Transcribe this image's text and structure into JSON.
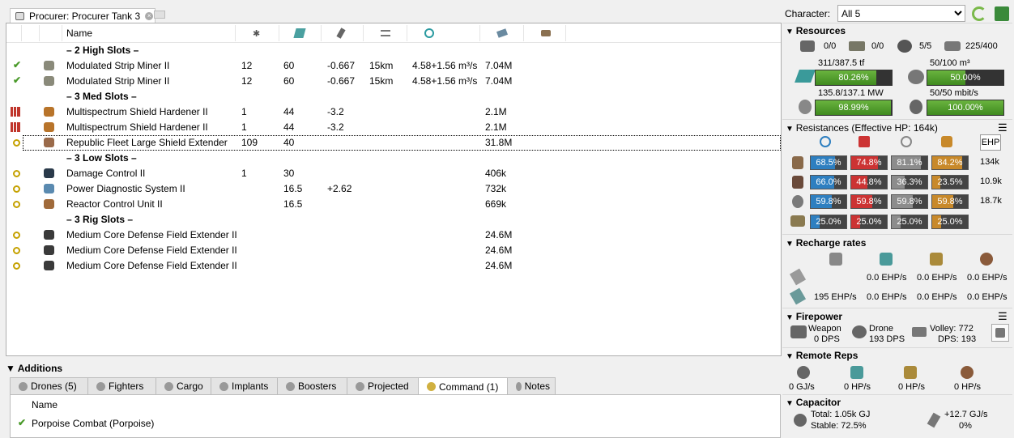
{
  "doc_tab": {
    "title": "Procurer: Procurer Tank 3"
  },
  "grid": {
    "header_name": "Name",
    "rows": [
      {
        "kind": "group",
        "name": "– 2 High Slots –"
      },
      {
        "kind": "mod",
        "status": "check",
        "icon_color": "#8a8a7a",
        "name": "Modulated Strip Miner II",
        "c1": "12",
        "c2": "60",
        "c3": "-0.667",
        "c4": "15km",
        "c5": "4.58+1.56 m³/s",
        "c6": "7.04M"
      },
      {
        "kind": "mod",
        "status": "check",
        "icon_color": "#8a8a7a",
        "name": "Modulated Strip Miner II",
        "c1": "12",
        "c2": "60",
        "c3": "-0.667",
        "c4": "15km",
        "c5": "4.58+1.56 m³/s",
        "c6": "7.04M"
      },
      {
        "kind": "group",
        "name": "– 3 Med Slots –"
      },
      {
        "kind": "mod",
        "status": "overload",
        "icon_color": "#b8742a",
        "name": "Multispectrum Shield Hardener II",
        "c1": "1",
        "c2": "44",
        "c3": "-3.2",
        "c4": "",
        "c5": "",
        "c6": "2.1M"
      },
      {
        "kind": "mod",
        "status": "overload",
        "icon_color": "#b8742a",
        "name": "Multispectrum Shield Hardener II",
        "c1": "1",
        "c2": "44",
        "c3": "-3.2",
        "c4": "",
        "c5": "",
        "c6": "2.1M"
      },
      {
        "kind": "mod",
        "status": "online",
        "icon_color": "#9a6a4a",
        "name": "Republic Fleet Large Shield Extender",
        "c1": "109",
        "c2": "40",
        "c3": "",
        "c4": "",
        "c5": "",
        "c6": "31.8M",
        "selected": true
      },
      {
        "kind": "group",
        "name": "– 3 Low Slots –"
      },
      {
        "kind": "mod",
        "status": "online",
        "icon_color": "#2a3a4a",
        "name": "Damage Control II",
        "c1": "1",
        "c2": "30",
        "c3": "",
        "c4": "",
        "c5": "",
        "c6": "406k"
      },
      {
        "kind": "mod",
        "status": "online",
        "icon_color": "#5a8ab0",
        "name": "Power Diagnostic System II",
        "c1": "",
        "c2": "16.5",
        "c3": "+2.62",
        "c4": "",
        "c5": "",
        "c6": "732k"
      },
      {
        "kind": "mod",
        "status": "online",
        "icon_color": "#a06a3a",
        "name": "Reactor Control Unit II",
        "c1": "",
        "c2": "16.5",
        "c3": "",
        "c4": "",
        "c5": "",
        "c6": "669k"
      },
      {
        "kind": "group",
        "name": "– 3 Rig Slots –"
      },
      {
        "kind": "mod",
        "status": "online",
        "icon_color": "#3a3a3a",
        "name": "Medium Core Defense Field Extender II",
        "c1": "",
        "c2": "",
        "c3": "",
        "c4": "",
        "c5": "",
        "c6": "24.6M"
      },
      {
        "kind": "mod",
        "status": "online",
        "icon_color": "#3a3a3a",
        "name": "Medium Core Defense Field Extender II",
        "c1": "",
        "c2": "",
        "c3": "",
        "c4": "",
        "c5": "",
        "c6": "24.6M"
      },
      {
        "kind": "mod",
        "status": "online",
        "icon_color": "#3a3a3a",
        "name": "Medium Core Defense Field Extender II",
        "c1": "",
        "c2": "",
        "c3": "",
        "c4": "",
        "c5": "",
        "c6": "24.6M"
      }
    ]
  },
  "additions": {
    "title": "Additions",
    "tabs": [
      "Drones (5)",
      "Fighters",
      "Cargo",
      "Implants",
      "Boosters",
      "Projected",
      "Command (1)",
      "Notes"
    ],
    "active_tab": 6,
    "col_name": "Name",
    "item": "Porpoise Combat (Porpoise)"
  },
  "character": {
    "label": "Character:",
    "value": "All 5"
  },
  "resources": {
    "title": "Resources",
    "counts": [
      "0/0",
      "0/0",
      "5/5",
      "225/400"
    ],
    "cpu": {
      "label": "311/387.5 tf",
      "pct_text": "80.26%",
      "pct": 0.8026
    },
    "drone_bay": {
      "label": "50/100 m³",
      "pct_text": "50.00%",
      "pct": 0.5
    },
    "pg": {
      "label": "135.8/137.1 MW",
      "pct_text": "98.99%",
      "pct": 0.9899
    },
    "bandwidth": {
      "label": "50/50 mbit/s",
      "pct_text": "100.00%",
      "pct": 1.0
    }
  },
  "resistances": {
    "title": "Resistances (Effective HP: 164k)",
    "ehp_button": "EHP",
    "rows": [
      {
        "vals": [
          "68.5%",
          "74.8%",
          "81.1%",
          "84.2%"
        ],
        "pcts": [
          0.685,
          0.748,
          0.811,
          0.842
        ],
        "ehp": "134k"
      },
      {
        "vals": [
          "66.0%",
          "44.8%",
          "36.3%",
          "23.5%"
        ],
        "pcts": [
          0.66,
          0.448,
          0.363,
          0.235
        ],
        "ehp": "10.9k"
      },
      {
        "vals": [
          "59.8%",
          "59.8%",
          "59.8%",
          "59.8%"
        ],
        "pcts": [
          0.598,
          0.598,
          0.598,
          0.598
        ],
        "ehp": "18.7k"
      },
      {
        "vals": [
          "25.0%",
          "25.0%",
          "25.0%",
          "25.0%"
        ],
        "pcts": [
          0.25,
          0.25,
          0.25,
          0.25
        ],
        "ehp": ""
      }
    ],
    "colors": [
      "#2e7fc0",
      "#c33",
      "#8c8c8c",
      "#c8892a"
    ]
  },
  "recharge": {
    "title": "Recharge rates",
    "row1": [
      "0.0 EHP/s",
      "0.0 EHP/s",
      "0.0 EHP/s"
    ],
    "row2": [
      "195 EHP/s",
      "0.0 EHP/s",
      "0.0 EHP/s",
      "0.0 EHP/s"
    ]
  },
  "firepower": {
    "title": "Firepower",
    "weapon_label": "Weapon",
    "weapon_dps": "0 DPS",
    "drone_label": "Drone",
    "drone_dps": "193 DPS",
    "volley": "Volley: 772",
    "dps": "DPS: 193"
  },
  "remote": {
    "title": "Remote Reps",
    "vals": [
      "0 GJ/s",
      "0 HP/s",
      "0 HP/s",
      "0 HP/s"
    ]
  },
  "capacitor": {
    "title": "Capacitor",
    "total": "Total: 1.05k GJ",
    "stable": "Stable: 72.5%",
    "delta": "+12.7 GJ/s",
    "pct": "0%"
  }
}
